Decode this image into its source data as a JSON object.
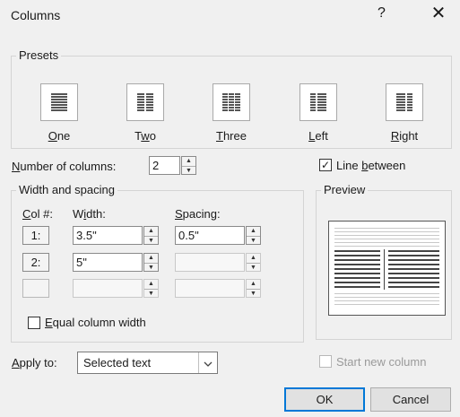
{
  "window": {
    "title": "Columns",
    "help": "?",
    "close": "✕"
  },
  "presets": {
    "label": "Presets",
    "items": [
      {
        "label": "One"
      },
      {
        "label": "Two"
      },
      {
        "label": "Three"
      },
      {
        "label": "Left"
      },
      {
        "label": "Right"
      }
    ]
  },
  "number_of_columns": {
    "label": "Number of columns:",
    "value": "2"
  },
  "line_between": {
    "label": "Line between",
    "checked": true
  },
  "width_spacing": {
    "label": "Width and spacing",
    "col_header": "Col #:",
    "width_header": "Width:",
    "spacing_header": "Spacing:",
    "rows": [
      {
        "col": "1:",
        "width": "3.5\"",
        "spacing": "0.5\""
      },
      {
        "col": "2:",
        "width": "5\"",
        "spacing": ""
      },
      {
        "col": "",
        "width": "",
        "spacing": ""
      }
    ]
  },
  "preview": {
    "label": "Preview"
  },
  "equal_width": {
    "label": "Equal column width",
    "checked": false
  },
  "apply_to": {
    "label": "Apply to:",
    "value": "Selected text"
  },
  "start_new_column": {
    "label": "Start new column",
    "checked": false
  },
  "buttons": {
    "ok": "OK",
    "cancel": "Cancel"
  }
}
